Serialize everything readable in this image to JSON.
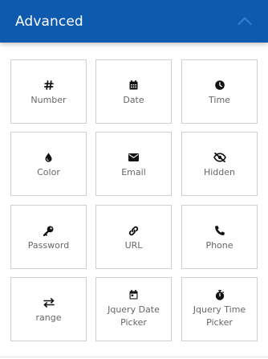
{
  "panel": {
    "title": "Advanced",
    "collapse_icon": "chevron-up-icon",
    "header_color": "#0d5aae"
  },
  "fields": [
    {
      "label": "Number",
      "icon": "hash-icon"
    },
    {
      "label": "Date",
      "icon": "calendar-icon"
    },
    {
      "label": "Time",
      "icon": "clock-icon"
    },
    {
      "label": "Color",
      "icon": "droplet-icon"
    },
    {
      "label": "Email",
      "icon": "envelope-icon"
    },
    {
      "label": "Hidden",
      "icon": "eye-slash-icon"
    },
    {
      "label": "Password",
      "icon": "key-icon"
    },
    {
      "label": "URL",
      "icon": "link-icon"
    },
    {
      "label": "Phone",
      "icon": "phone-icon"
    },
    {
      "label": "range",
      "icon": "exchange-arrows-icon"
    },
    {
      "label": "Jquery Date Picker",
      "icon": "calendar-day-icon"
    },
    {
      "label": "Jquery Time Picker",
      "icon": "stopwatch-icon"
    }
  ]
}
